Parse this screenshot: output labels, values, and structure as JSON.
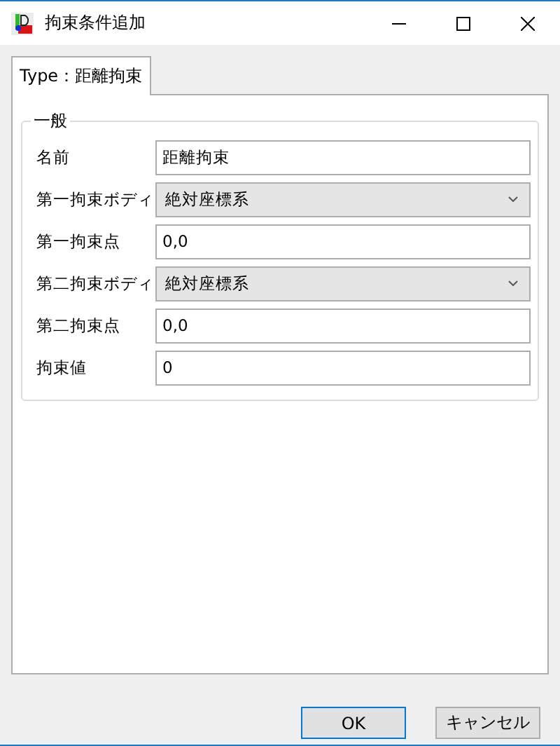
{
  "window": {
    "title": "拘束条件追加"
  },
  "tabs": [
    {
      "label": "Type：距離拘束",
      "selected": true
    }
  ],
  "group": {
    "title": "一般",
    "fields": [
      {
        "label": "名前",
        "kind": "text",
        "value": "距離拘束"
      },
      {
        "label": "第一拘束ボディ",
        "kind": "select",
        "value": "絶対座標系"
      },
      {
        "label": "第一拘束点",
        "kind": "text",
        "value": "0,0"
      },
      {
        "label": "第二拘束ボディ",
        "kind": "select",
        "value": "絶対座標系"
      },
      {
        "label": "第二拘束点",
        "kind": "text",
        "value": "0,0"
      },
      {
        "label": "拘束値",
        "kind": "text",
        "value": "0"
      }
    ]
  },
  "buttons": [
    {
      "label": "OK",
      "default": true
    },
    {
      "label": "キャンセル",
      "default": false
    }
  ]
}
